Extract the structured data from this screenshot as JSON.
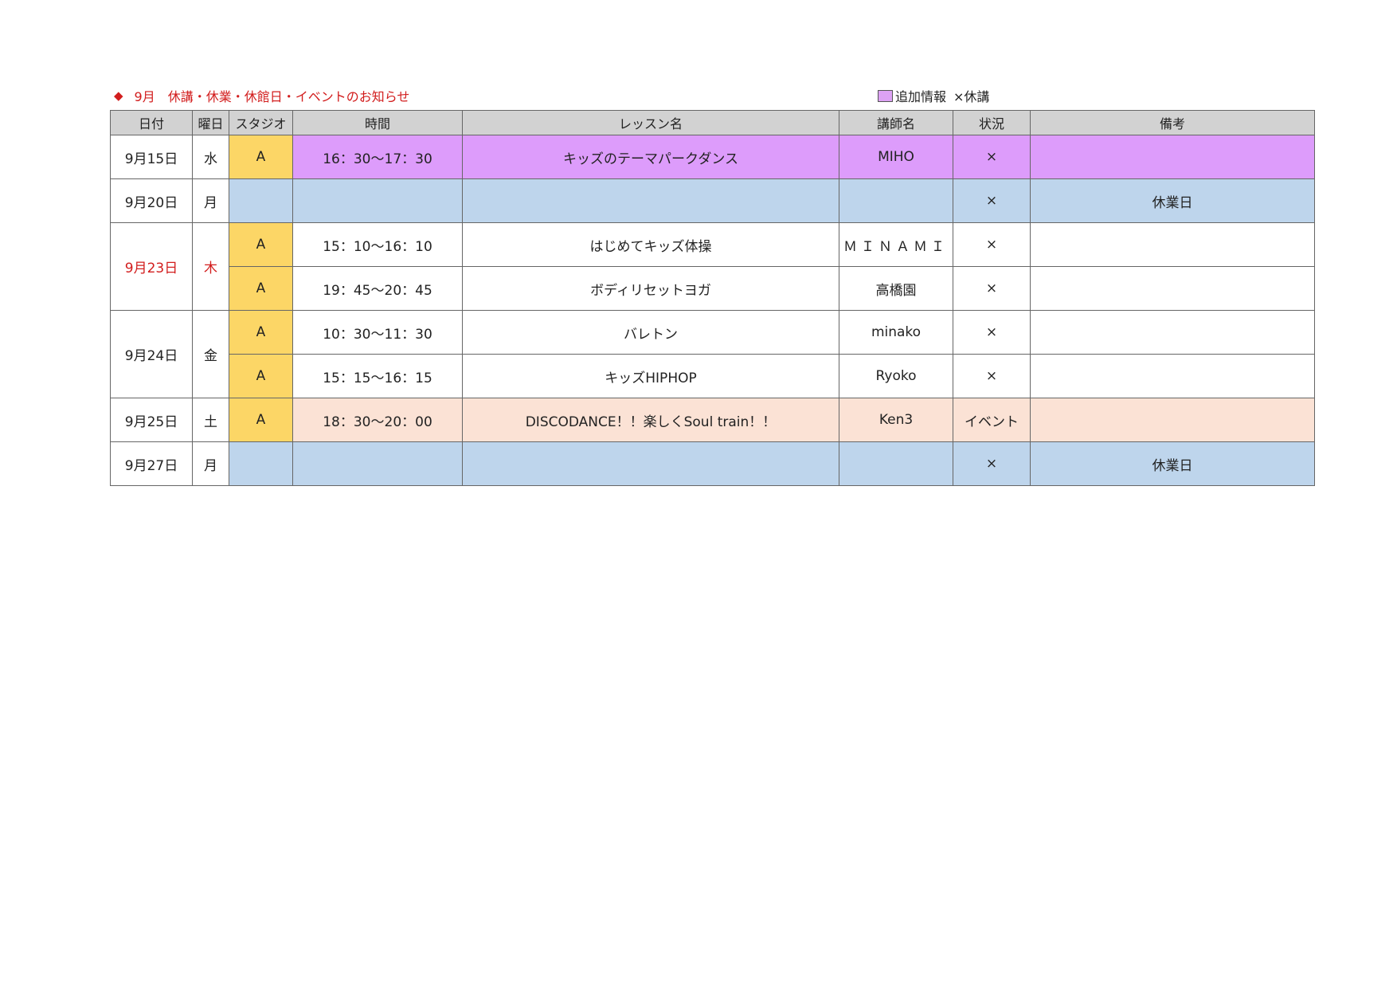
{
  "header": {
    "marker": "◆",
    "title": "9月　休講・休業・休館日・イベントのお知らせ",
    "legend_swatch_label": "追加情報",
    "legend_cancel_label": "×休講"
  },
  "colors": {
    "title_red": "#d21d1d",
    "header_gray": "#d2d2d2",
    "extra_info_purple": "#dd9cfb",
    "closed_blue": "#bed5ec",
    "event_peach": "#fbe2d5",
    "studio_yellow": "#fcd666"
  },
  "table": {
    "columns": [
      "日付",
      "曜日",
      "スタジオ",
      "時間",
      "レッスン名",
      "講師名",
      "状況",
      "備考"
    ],
    "groups": [
      {
        "date": "9月15日",
        "weekday": "水",
        "holiday": false,
        "rows": [
          {
            "studio": "A",
            "time": "16：30～17：30",
            "lesson": "キッズのテーマパークダンス",
            "instructor": "MIHO",
            "status": "×",
            "note": "",
            "style": "purple"
          }
        ]
      },
      {
        "date": "9月20日",
        "weekday": "月",
        "holiday": false,
        "rows": [
          {
            "studio": "",
            "time": "",
            "lesson": "",
            "instructor": "",
            "status": "×",
            "note": "休業日",
            "style": "blue"
          }
        ]
      },
      {
        "date": "9月23日",
        "weekday": "木",
        "holiday": true,
        "rows": [
          {
            "studio": "A",
            "time": "15：10～16：10",
            "lesson": "はじめてキッズ体操",
            "instructor": "ＭＩＮＡＭＩ",
            "status": "×",
            "note": "",
            "style": "white"
          },
          {
            "studio": "A",
            "time": "19：45～20：45",
            "lesson": "ボディリセットヨガ",
            "instructor": "高橋園",
            "status": "×",
            "note": "",
            "style": "white"
          }
        ]
      },
      {
        "date": "9月24日",
        "weekday": "金",
        "holiday": false,
        "rows": [
          {
            "studio": "A",
            "time": "10：30～11：30",
            "lesson": "バレトン",
            "instructor": "minako",
            "status": "×",
            "note": "",
            "style": "white"
          },
          {
            "studio": "A",
            "time": "15：15～16：15",
            "lesson": "キッズHIPHOP",
            "instructor": "Ryoko",
            "status": "×",
            "note": "",
            "style": "white"
          }
        ]
      },
      {
        "date": "9月25日",
        "weekday": "土",
        "holiday": false,
        "rows": [
          {
            "studio": "A",
            "time": "18：30～20：00",
            "lesson": "DISCODANCE！！楽しくSoul train！！",
            "instructor": "Ken3",
            "status": "イベント",
            "note": "",
            "style": "peach"
          }
        ]
      },
      {
        "date": "9月27日",
        "weekday": "月",
        "holiday": false,
        "rows": [
          {
            "studio": "",
            "time": "",
            "lesson": "",
            "instructor": "",
            "status": "×",
            "note": "休業日",
            "style": "blue"
          }
        ]
      }
    ]
  }
}
